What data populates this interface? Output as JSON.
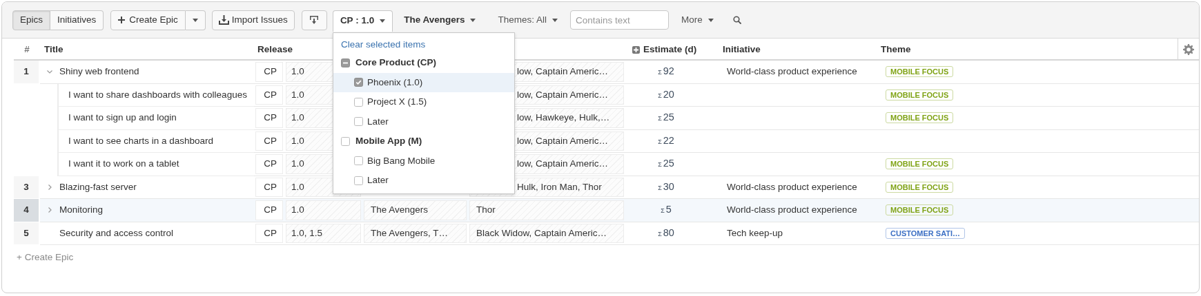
{
  "view_tabs": [
    {
      "label": "Epics",
      "selected": true
    },
    {
      "label": "Initiatives",
      "selected": false
    }
  ],
  "create_button": {
    "label": "Create Epic"
  },
  "import_button": {
    "label": "Import Issues"
  },
  "filters": [
    {
      "label": "CP : 1.0",
      "active": true,
      "open": true
    },
    {
      "label": "The Avengers",
      "active": true,
      "open": false
    },
    {
      "label": "Themes: All",
      "active": false,
      "open": false
    }
  ],
  "search": {
    "placeholder": "Contains text"
  },
  "more": {
    "label": "More"
  },
  "columns": [
    {
      "kind": "number",
      "label": "#"
    },
    {
      "kind": "title",
      "label": "Title"
    },
    {
      "kind": "release",
      "label": "Release"
    },
    {
      "kind": "estimate",
      "label": "Estimate (d)"
    },
    {
      "kind": "initiative",
      "label": "Initiative"
    },
    {
      "kind": "theme",
      "label": "Theme"
    }
  ],
  "rows": [
    {
      "number": "1",
      "title": "Shiny web frontend",
      "expanded": true,
      "selected": false,
      "product": "CP",
      "release": "1.0",
      "members": "low, Captain Americ…",
      "estimate_prefix": "Σ",
      "estimate": "92",
      "initiative": "World-class product experience",
      "themes": [
        {
          "label": "MOBILE FOCUS",
          "color": "#7fa314"
        }
      ],
      "children": [
        {
          "title": "I want to share dashboards with colleagues",
          "product": "CP",
          "release": "1.0",
          "members": "low, Captain Americ…",
          "estimate_prefix": "Σ",
          "estimate": "20",
          "themes": [
            {
              "label": "MOBILE FOCUS",
              "color": "#7fa314"
            }
          ]
        },
        {
          "title": "I want to sign up and login",
          "product": "CP",
          "release": "1.0",
          "members": "low, Hawkeye, Hulk,…",
          "estimate_prefix": "Σ",
          "estimate": "25",
          "themes": [
            {
              "label": "MOBILE FOCUS",
              "color": "#7fa314"
            }
          ]
        },
        {
          "title": "I want to see charts in a dashboard",
          "product": "CP",
          "release": "1.0",
          "members": "low, Captain Americ…",
          "estimate_prefix": "Σ",
          "estimate": "22"
        },
        {
          "title": "I want it to work on a tablet",
          "product": "CP",
          "release": "1.0",
          "members": "low, Captain Americ…",
          "estimate_prefix": "Σ",
          "estimate": "25",
          "themes": [
            {
              "label": "MOBILE FOCUS",
              "color": "#7fa314"
            }
          ]
        }
      ]
    },
    {
      "number": "3",
      "title": "Blazing-fast server",
      "expanded": false,
      "selected": false,
      "product": "CP",
      "release": "1.0",
      "members": "Hulk, Iron Man, Thor",
      "estimate_prefix": "Σ",
      "estimate": "30",
      "initiative": "World-class product experience",
      "themes": [
        {
          "label": "MOBILE FOCUS",
          "color": "#7fa314"
        }
      ]
    },
    {
      "number": "4",
      "title": "Monitoring",
      "expanded": false,
      "selected": true,
      "product": "CP",
      "release": "1.0",
      "team": "The Avengers",
      "members": "Thor",
      "estimate_prefix": "Σ",
      "estimate": "5",
      "initiative": "World-class product experience",
      "themes": [
        {
          "label": "MOBILE FOCUS",
          "color": "#7fa314"
        }
      ]
    },
    {
      "number": "5",
      "title": "Security and access control",
      "selected": false,
      "product": "CP",
      "release": "1.0, 1.5",
      "team": "The Avengers, T…",
      "members": "Black Widow, Captain Americ…",
      "estimate_prefix": "Σ",
      "estimate": "80",
      "initiative": "Tech keep-up",
      "themes": [
        {
          "label": "CUSTOMER SATI…",
          "color": "#3b6fc4"
        }
      ]
    }
  ],
  "add_link": {
    "label": "+ Create Epic"
  },
  "release_menu": {
    "clear_link": "Clear selected items",
    "groups": [
      {
        "label": "Core Product (CP)",
        "checked": false,
        "partial": true,
        "items": [
          {
            "label": "Phoenix (1.0)",
            "checked": true,
            "highlighted": true
          },
          {
            "label": "Project X (1.5)",
            "checked": false,
            "highlighted": false
          },
          {
            "label": "Later",
            "checked": false,
            "highlighted": false
          }
        ]
      },
      {
        "label": "Mobile App (M)",
        "checked": false,
        "partial": false,
        "items": [
          {
            "label": "Big Bang Mobile",
            "checked": false,
            "highlighted": false
          },
          {
            "label": "Later",
            "checked": false,
            "highlighted": false
          }
        ]
      }
    ]
  }
}
